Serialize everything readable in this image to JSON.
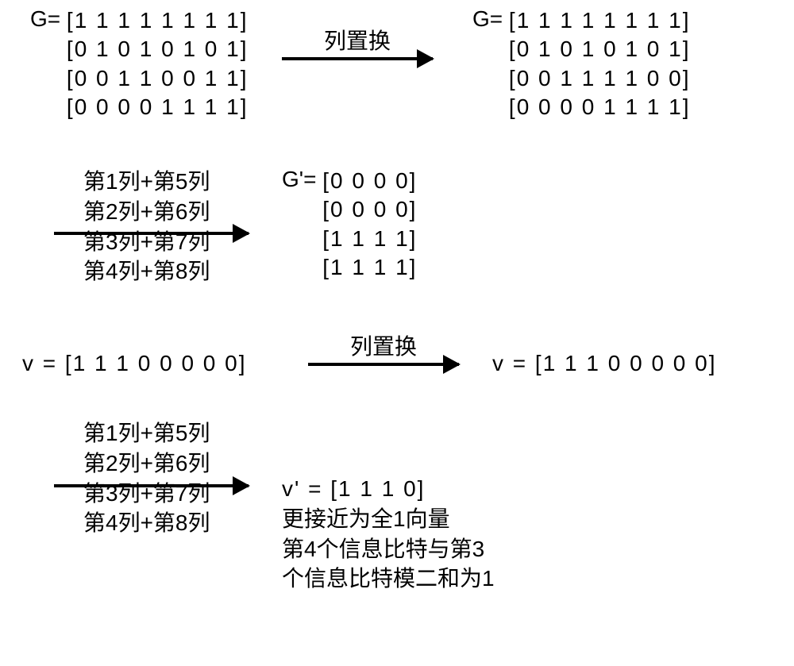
{
  "matrix_G_left": {
    "label": "G=",
    "rows": [
      "[1 1 1 1 1 1 1 1]",
      "[0 1 0 1 0 1 0 1]",
      "[0 0 1 1 0 0 1 1]",
      "[0 0 0 0 1 1 1 1]"
    ]
  },
  "arrow_top": {
    "label": "列置换"
  },
  "matrix_G_right": {
    "label": "G=",
    "rows": [
      "[1 1 1 1 1 1 1 1]",
      "[0 1 0 1 0 1 0 1]",
      "[0 0 1 1 1 1 0 0]",
      "[0 0 0 0 1 1 1 1]"
    ]
  },
  "col_ops": {
    "lines": [
      "第1列+第5列",
      "第2列+第6列",
      "第3列+第7列",
      "第4列+第8列"
    ]
  },
  "matrix_G_prime": {
    "label": "G'=",
    "rows": [
      "[0 0 0 0]",
      "[0 0 0 0]",
      "[1 1 1 1]",
      "[1 1 1 1]"
    ]
  },
  "vector_v_left": "v = [1 1 1 0 0 0 0 0]",
  "arrow_v": {
    "label": "列置换"
  },
  "vector_v_right": "v = [1 1 1 0 0 0 0 0]",
  "vector_v_prime": "v' = [1 1 1 0]",
  "description": {
    "line1": "更接近为全1向量",
    "line2": "第4个信息比特与第3",
    "line3": "个信息比特模二和为1"
  }
}
